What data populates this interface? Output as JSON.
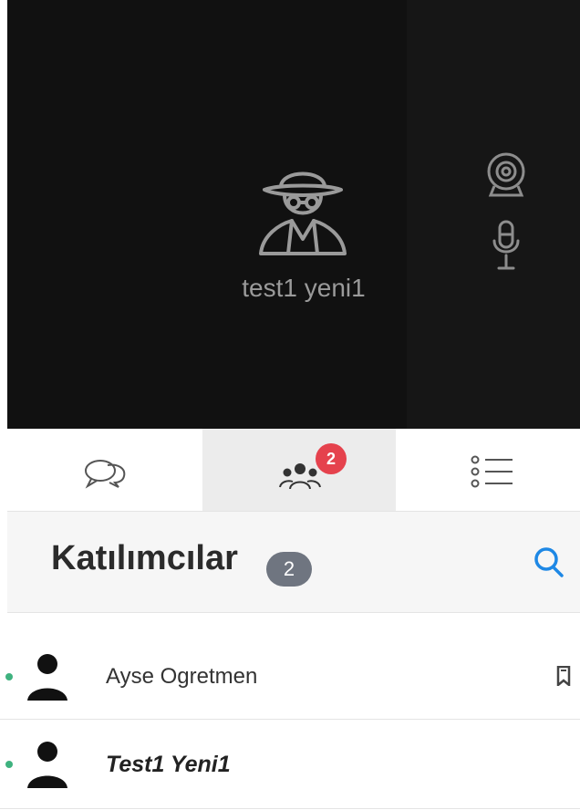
{
  "video": {
    "participant_name": "test1 yeni1",
    "avatar_icon": "spy-avatar-icon",
    "controls": [
      "webcam-icon",
      "microphone-icon"
    ]
  },
  "tabs": [
    {
      "icon": "chat-bubbles-icon",
      "active": false
    },
    {
      "icon": "participants-icon",
      "active": true,
      "badge": "2"
    },
    {
      "icon": "list-icon",
      "active": false
    }
  ],
  "participants": {
    "title": "Katılımcılar",
    "count": "2",
    "search_icon": "search-icon",
    "items": [
      {
        "name": "Ayse Ogretmen",
        "status": "online",
        "status_color": "#3fb27f",
        "bookmark": true
      },
      {
        "name": "Test1 Yeni1",
        "status": "online",
        "status_color": "#3fb27f",
        "bookmark": false
      }
    ]
  },
  "colors": {
    "video_background": "#111111",
    "active_tab": "#ececec",
    "badge_red": "#e5424d",
    "count_badge": "#6f7580",
    "search_blue": "#1e88e5"
  }
}
